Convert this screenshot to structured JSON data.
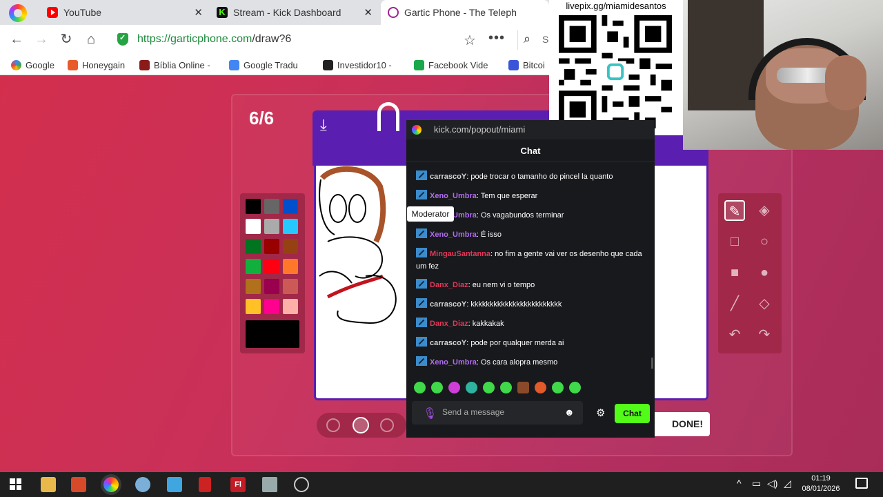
{
  "browser": {
    "tabs": [
      {
        "title": "YouTube",
        "close": "✕"
      },
      {
        "title": "Stream - Kick Dashboard",
        "close": "✕"
      },
      {
        "title": "Gartic Phone - The Teleph",
        "close": ""
      }
    ],
    "url_host": "https://garticphone.com",
    "url_path": "/draw?6",
    "search_placeholder": "Se",
    "bookmarks": [
      "Google",
      "Honeygain",
      "Bíblia Online -",
      "Google Tradu",
      "Investidor10 -",
      "Facebook Vide",
      "Bitcoi"
    ]
  },
  "game": {
    "round": "6/6",
    "done_label": "DONE!",
    "palette": [
      "#000000",
      "#666666",
      "#0050cd",
      "#ffffff",
      "#aaaaaa",
      "#26c9ff",
      "#017420",
      "#990000",
      "#964112",
      "#11b03c",
      "#ff0013",
      "#ff7829",
      "#b0701c",
      "#99004e",
      "#cb5a57",
      "#ffc126",
      "#ff008f",
      "#feafa8"
    ],
    "active_color": "#000000",
    "tools": [
      "pen-icon",
      "fill-icon",
      "rect-outline-icon",
      "circle-outline-icon",
      "rect-filled-icon",
      "circle-filled-icon",
      "line-icon",
      "eraser-icon",
      "undo-icon",
      "redo-icon"
    ]
  },
  "stream_overlay": {
    "qr_caption": "livepix.gg/miamidesantos"
  },
  "chat": {
    "popup_url": "kick.com/popout/miami",
    "header": "Chat",
    "tooltip": "Moderator",
    "messages": [
      {
        "user": "carrascoY",
        "color": "#d6d6d6",
        "text": "pode trocar o tamanho do pincel la quanto"
      },
      {
        "user": "Xeno_Umbra",
        "color": "#b06cf0",
        "text": "Tem que esperar"
      },
      {
        "user": "Xeno_Umbra",
        "color": "#b06cf0",
        "text": "Os vagabundos terminar"
      },
      {
        "user": "Xeno_Umbra",
        "color": "#b06cf0",
        "text": "É isso"
      },
      {
        "user": "MingauSantanna",
        "color": "#e0385a",
        "text": "no fim a gente vai ver os desenho que cada um fez"
      },
      {
        "user": "Danx_Diaz",
        "color": "#e0385a",
        "text": "eu nem vi o tempo"
      },
      {
        "user": "carrascoY",
        "color": "#d6d6d6",
        "text": "kkkkkkkkkkkkkkkkkkkkkkkk"
      },
      {
        "user": "Danx_Diaz",
        "color": "#e0385a",
        "text": "kakkakak"
      },
      {
        "user": "carrascoY",
        "color": "#d6d6d6",
        "text": "pode por qualquer merda ai"
      },
      {
        "user": "Xeno_Umbra",
        "color": "#b06cf0",
        "text": "Os cara alopra mesmo"
      }
    ],
    "input_placeholder": "Send a message",
    "send_label": "Chat"
  },
  "taskbar": {
    "time": "01:19",
    "date": "08/01/2026"
  }
}
